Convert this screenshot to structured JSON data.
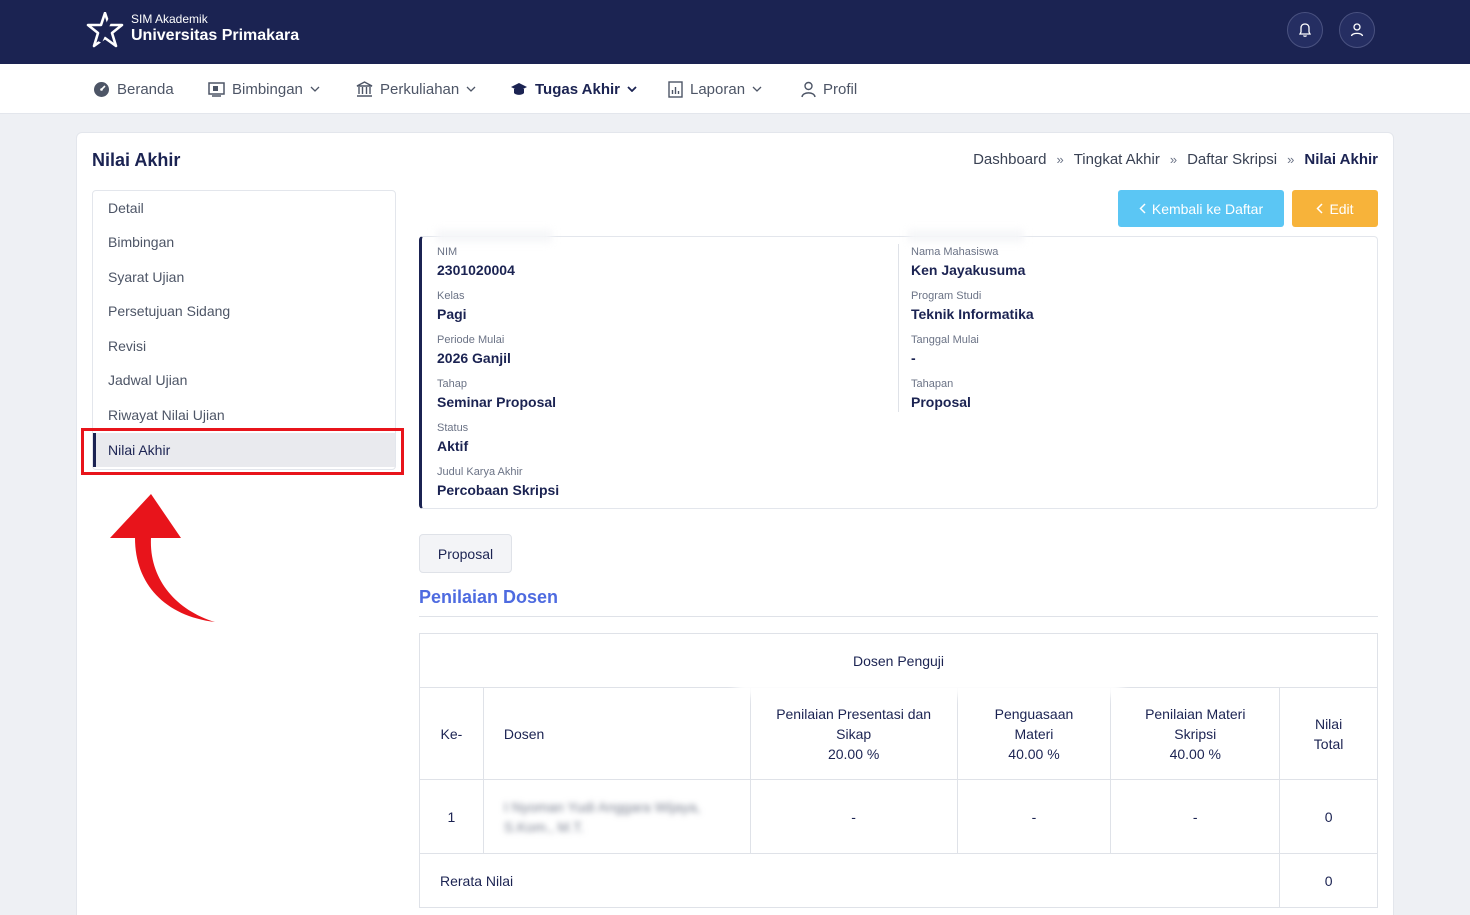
{
  "header": {
    "brand_sub": "SIM Akademik",
    "brand_name": "Universitas Primakara",
    "icons": [
      "bell-icon",
      "user-icon"
    ]
  },
  "nav": [
    {
      "label": "Beranda",
      "icon": "dashboard-icon",
      "dropdown": false
    },
    {
      "label": "Bimbingan",
      "icon": "board-icon",
      "dropdown": true
    },
    {
      "label": "Perkuliahan",
      "icon": "building-icon",
      "dropdown": true
    },
    {
      "label": "Tugas Akhir",
      "icon": "graduation-cap-icon",
      "dropdown": true,
      "active": true
    },
    {
      "label": "Laporan",
      "icon": "report-icon",
      "dropdown": true
    },
    {
      "label": "Profil",
      "icon": "user-icon",
      "dropdown": false
    }
  ],
  "page": {
    "title": "Nilai Akhir",
    "breadcrumb": [
      "Dashboard",
      "Tingkat Akhir",
      "Daftar Skripsi",
      "Nilai Akhir"
    ]
  },
  "side_menu": [
    "Detail",
    "Bimbingan",
    "Syarat Ujian",
    "Persetujuan Sidang",
    "Revisi",
    "Jadwal Ujian",
    "Riwayat Nilai Ujian",
    "Nilai Akhir"
  ],
  "buttons": {
    "back": "Kembali ke Daftar",
    "edit": "Edit"
  },
  "info": {
    "left": [
      {
        "label": "NIM",
        "value": "2301020004"
      },
      {
        "label": "Kelas",
        "value": "Pagi"
      },
      {
        "label": "Periode Mulai",
        "value": "2026 Ganjil"
      },
      {
        "label": "Tahap",
        "value": "Seminar Proposal"
      },
      {
        "label": "Status",
        "value": "Aktif"
      },
      {
        "label": "Judul Karya Akhir",
        "value": "Percobaan Skripsi"
      }
    ],
    "right": [
      {
        "label": "Nama Mahasiswa",
        "value": "Ken Jayakusuma"
      },
      {
        "label": "Program Studi",
        "value": "Teknik Informatika"
      },
      {
        "label": "Tanggal Mulai",
        "value": "-"
      },
      {
        "label": "Tahapan",
        "value": "Proposal"
      }
    ]
  },
  "tab": "Proposal",
  "section_title": "Penilaian Dosen",
  "table": {
    "group_header": "Dosen Penguji",
    "col_ke": "Ke-",
    "col_dosen": "Dosen",
    "col_presentasi": "Penilaian Presentasi dan Sikap",
    "col_presentasi_pct": "20.00 %",
    "col_penguasaan": "Penguasaan Materi",
    "col_penguasaan_pct": "40.00 %",
    "col_materi": "Penilaian Materi Skripsi",
    "col_materi_pct": "40.00 %",
    "col_total": "Nilai Total",
    "rows": [
      {
        "ke": "1",
        "dosen": "I Nyoman Yudi Anggara Wijaya, S.Kom., M.T.",
        "presentasi": "-",
        "penguasaan": "-",
        "materi": "-",
        "total": "0"
      }
    ],
    "rerata_label": "Rerata Nilai",
    "rerata_value": "0"
  }
}
